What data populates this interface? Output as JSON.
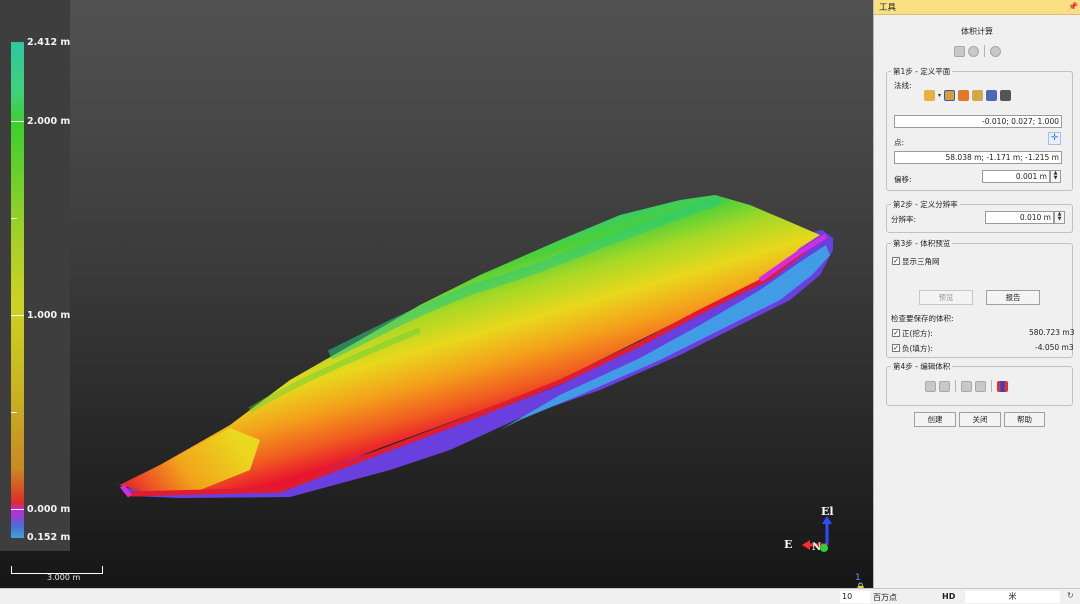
{
  "colorbar": {
    "labels": {
      "max": "2.412 m",
      "high": "2.000 m",
      "mid": "1.000 m",
      "zero": "0.000 m",
      "min": "0.152 m"
    }
  },
  "scale_bar": {
    "label": "3.000 m"
  },
  "axes": {
    "up": "El",
    "east": "E",
    "north": "N"
  },
  "camera_indicator": "1",
  "panel": {
    "header": "工具",
    "title": "体积计算",
    "step1": {
      "legend": "第1步 - 定义平面",
      "normal_label": "法线:",
      "normal_value": "-0.010; 0.027; 1.000",
      "point_label": "点:",
      "point_value": "58.038 m; -1.171 m; -1.215 m",
      "offset_label": "偏移:",
      "offset_value": "0.001 m"
    },
    "step2": {
      "legend": "第2步 - 定义分辨率",
      "resolution_label": "分辨率:",
      "resolution_value": "0.010 m"
    },
    "step3": {
      "legend": "第3步 - 体积预览",
      "show_triangles": "显示三角网",
      "preview_button": "预览",
      "report_button": "报告",
      "check_label": "检查要保存的体积:",
      "positive_label": "正(挖方):",
      "positive_value": "580.723 m3",
      "negative_label": "负(填方):",
      "negative_value": "-4.050 m3"
    },
    "step4": {
      "legend": "第4步 - 编辑体积"
    },
    "buttons": {
      "create": "创建",
      "close": "关闭",
      "help": "帮助"
    }
  },
  "statusbar": {
    "point_count": "10",
    "point_unit": "百万点",
    "hd": "HD",
    "unit": "米"
  },
  "colors": {
    "header_bg": "#fbe083",
    "viewport_bg": "#3b3b3b"
  }
}
